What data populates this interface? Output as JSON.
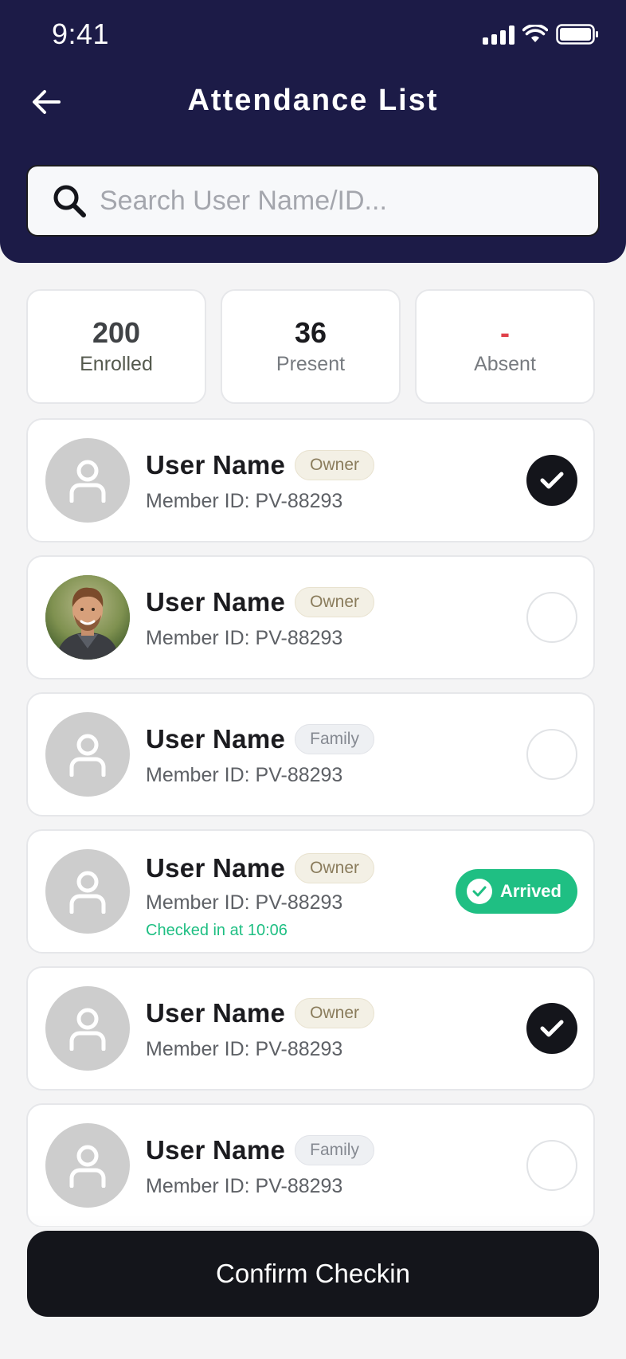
{
  "status_bar": {
    "time": "9:41"
  },
  "header": {
    "title": "Attendance List"
  },
  "search": {
    "placeholder": "Search User Name/ID...",
    "value": ""
  },
  "stats": {
    "enrolled": {
      "value": "200",
      "label": "Enrolled"
    },
    "present": {
      "value": "36",
      "label": "Present"
    },
    "absent": {
      "value": "-",
      "label": "Absent"
    }
  },
  "members": [
    {
      "name": "User Name",
      "role": "Owner",
      "member_id": "Member ID: PV-88293",
      "state": "checked",
      "avatar": "placeholder"
    },
    {
      "name": "User Name",
      "role": "Owner",
      "member_id": "Member ID: PV-88293",
      "state": "unchecked",
      "avatar": "photo"
    },
    {
      "name": "User Name",
      "role": "Family",
      "member_id": "Member ID: PV-88293",
      "state": "unchecked",
      "avatar": "placeholder"
    },
    {
      "name": "User Name",
      "role": "Owner",
      "member_id": "Member ID: PV-88293",
      "state": "arrived",
      "arrived_label": "Arrived",
      "checked_in_text": "Checked in at 10:06",
      "avatar": "placeholder"
    },
    {
      "name": "User Name",
      "role": "Owner",
      "member_id": "Member ID: PV-88293",
      "state": "checked",
      "avatar": "placeholder"
    },
    {
      "name": "User Name",
      "role": "Family",
      "member_id": "Member ID: PV-88293",
      "state": "unchecked",
      "avatar": "placeholder"
    }
  ],
  "footer": {
    "confirm_label": "Confirm Checkin"
  },
  "colors": {
    "header_bg": "#1c1b47",
    "arrived_green": "#1fbf83",
    "absent_red": "#e0424b",
    "primary_dark": "#14151b"
  },
  "icons": {
    "back": "arrow-left-icon",
    "search": "search-icon",
    "check": "check-icon",
    "user": "user-icon"
  }
}
